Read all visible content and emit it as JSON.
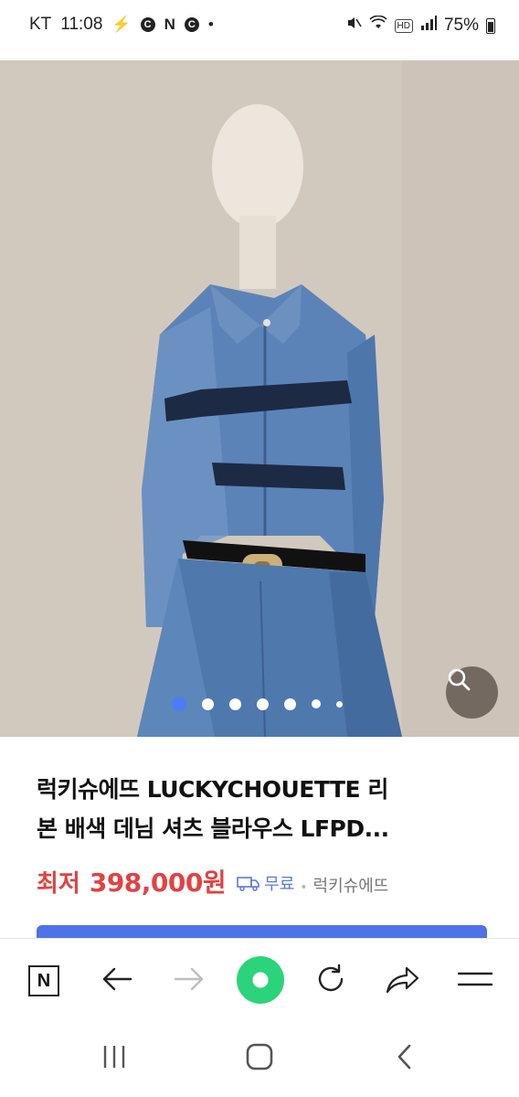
{
  "status_bar": {
    "carrier": "KT",
    "time": "11:08",
    "hd_label": "HD",
    "battery": "75%",
    "icons": [
      "flash-icon",
      "c-badge-icon",
      "n-icon",
      "c-badge-icon",
      "dot-icon",
      "mute-icon",
      "wifi-icon",
      "hd-icon",
      "signal-icon",
      "battery-icon"
    ]
  },
  "gallery": {
    "image_alt": "denim shirt on mannequin",
    "dot_count": 7,
    "active_dot": 1,
    "search_icon": "magnifier-icon"
  },
  "product": {
    "title_line1": "럭키슈에뜨 LUCKYCHOUETTE 리",
    "title_line2": "본 배색 데님 셔츠 블라우스 LFPD...",
    "price_label": "최저",
    "price_value": "398,000원",
    "shipping": "무료",
    "separator": "•",
    "seller": "럭키슈에뜨",
    "accent_color": "#e04343",
    "link_color": "#5c7ad0"
  },
  "toolbar": {
    "n_label": "N",
    "buttons": [
      "naver-home-icon",
      "back-arrow-icon",
      "forward-arrow-icon",
      "green-home-icon",
      "reload-icon",
      "share-icon",
      "menu-icon"
    ]
  },
  "nav": {
    "buttons": [
      "recents-icon",
      "home-icon",
      "back-icon"
    ]
  }
}
